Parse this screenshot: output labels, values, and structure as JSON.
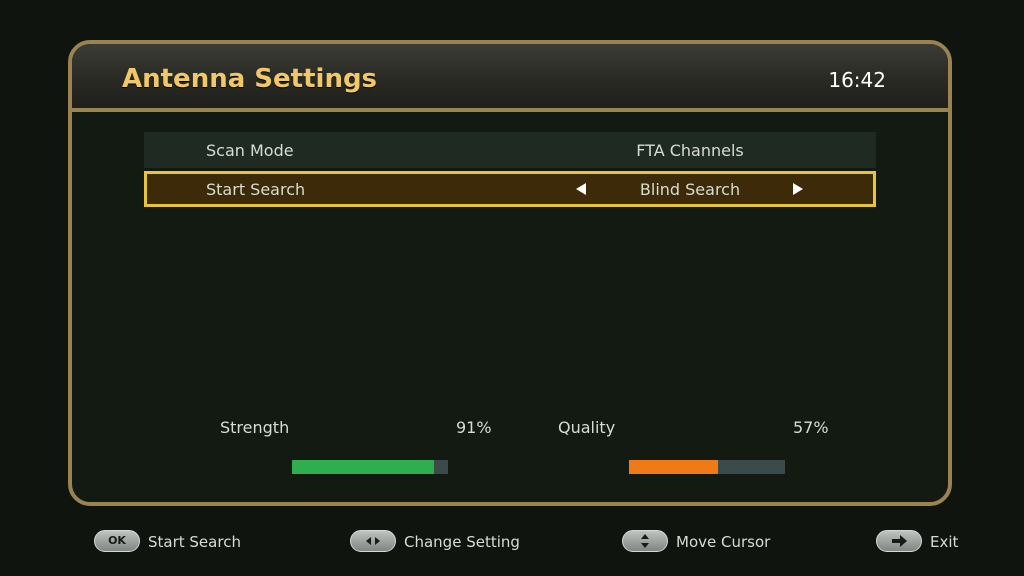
{
  "header": {
    "title": "Antenna Settings",
    "clock": "16:42"
  },
  "settings": [
    {
      "label": "Scan Mode",
      "value": "FTA Channels",
      "selected": false
    },
    {
      "label": "Start Search",
      "value": "Blind Search",
      "selected": true
    }
  ],
  "meters": {
    "strength": {
      "label": "Strength",
      "value_text": "91%",
      "fraction": 0.91,
      "color": "#2fae4f"
    },
    "quality": {
      "label": "Quality",
      "value_text": "57%",
      "fraction": 0.57,
      "color": "#f07a16"
    }
  },
  "footer": [
    {
      "key": "OK",
      "label": "Start Search"
    },
    {
      "key_icon": "left-right-arrows-icon",
      "label": "Change Setting"
    },
    {
      "key_icon": "up-down-arrows-icon",
      "label": "Move Cursor"
    },
    {
      "key_icon": "exit-arrow-icon",
      "label": "Exit"
    }
  ]
}
